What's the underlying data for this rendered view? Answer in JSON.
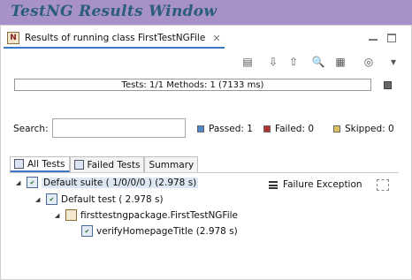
{
  "banner": {
    "title": "TestNG Results Window"
  },
  "view_tab": {
    "title": "Results of running class FirstTestNGFile",
    "icon": "testng-icon",
    "close": "✕"
  },
  "window_controls": [
    "minimize-icon",
    "maximize-icon"
  ],
  "toolbar": [
    {
      "name": "rerun-failed-icon",
      "glyph": "▤"
    },
    {
      "name": "next-failure-icon",
      "glyph": "⇩"
    },
    {
      "name": "previous-failure-icon",
      "glyph": "⇧"
    },
    {
      "name": "search-icon",
      "glyph": "🔍"
    },
    {
      "name": "filter-icon",
      "glyph": "▦"
    },
    {
      "name": "history-icon",
      "glyph": "◎"
    },
    {
      "name": "view-menu-icon",
      "glyph": "▾"
    }
  ],
  "progress": {
    "text": "Tests: 1/1  Methods: 1 (7133 ms)",
    "fraction": 1.0,
    "color": "#ffffff"
  },
  "search": {
    "label": "Search:",
    "value": "",
    "placeholder": ""
  },
  "stats": {
    "passed": {
      "label": "Passed: 1",
      "color": "#4f86c6"
    },
    "failed": {
      "label": "Failed: 0",
      "color": "#b23030"
    },
    "skipped": {
      "label": "Skipped: 0",
      "color": "#e0c060"
    }
  },
  "result_tabs": [
    {
      "label": "All Tests",
      "active": true
    },
    {
      "label": "Failed Tests",
      "active": false
    },
    {
      "label": "Summary",
      "active": false
    }
  ],
  "tree": {
    "suite": "Default suite ( 1/0/0/0 ) (2.978 s)",
    "test": "Default test ( 2.978 s)",
    "class": "firsttestngpackage.FirstTestNGFile",
    "method": "verifyHomepageTitle  (2.978 s)"
  },
  "failure_panel": {
    "title": "Failure Exception"
  }
}
